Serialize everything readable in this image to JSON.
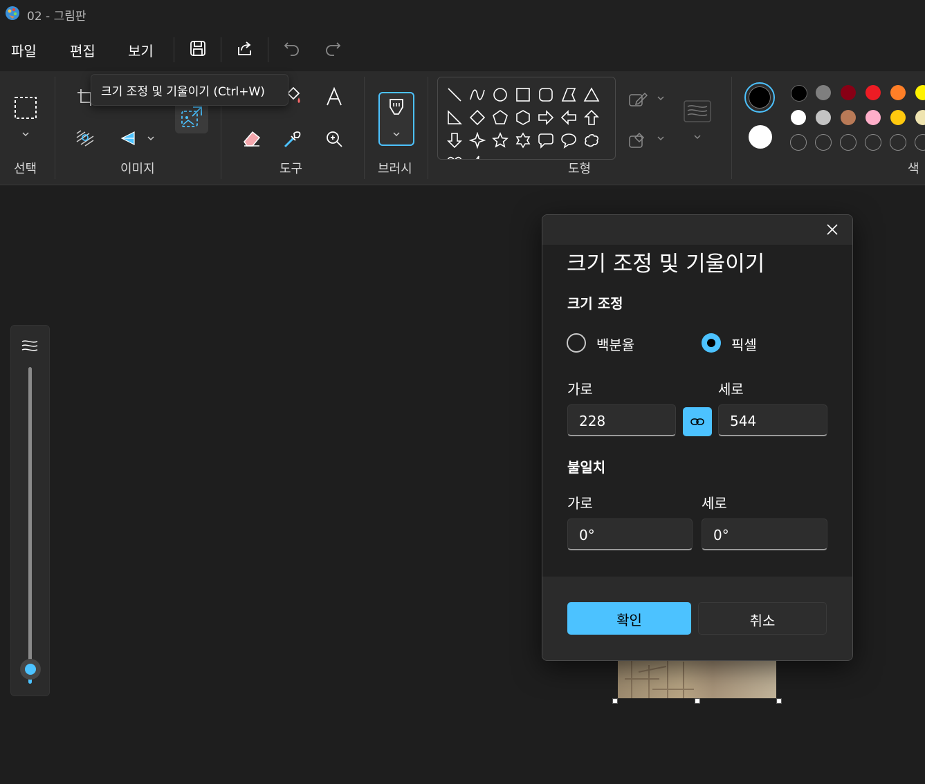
{
  "window": {
    "title": "02 - 그림판"
  },
  "menu": {
    "file": "파일",
    "edit": "편집",
    "view": "보기"
  },
  "ribbon": {
    "groups": {
      "select": "선택",
      "image": "이미지",
      "tools": "도구",
      "brush": "브러시",
      "shapes": "도형",
      "color": "색"
    },
    "tooltip": "크기 조정 및 기울이기 (Ctrl+W)"
  },
  "colors": {
    "primary": "#000000",
    "secondary": "#ffffff",
    "accent": "#4cc2ff",
    "palette_row1": [
      "#000000",
      "#7f7f7f",
      "#880015",
      "#ed1c24",
      "#ff7f27",
      "#fff200"
    ],
    "palette_row2": [
      "#ffffff",
      "#c3c3c3",
      "#b97a57",
      "#ffaec9",
      "#ffc90e",
      "#efe4b0"
    ]
  },
  "dialog": {
    "title": "크기 조정 및 기울이기",
    "resize_section": "크기 조정",
    "option_percent": "백분율",
    "option_pixel": "픽셀",
    "selected_option": "픽셀",
    "horizontal_label": "가로",
    "vertical_label": "세로",
    "width_value": "228",
    "height_value": "544",
    "skew_section": "불일치",
    "skew_horizontal_label": "가로",
    "skew_vertical_label": "세로",
    "skew_horizontal_value": "0°",
    "skew_vertical_value": "0°",
    "ok": "확인",
    "cancel": "취소"
  },
  "brush_size_slider": {
    "value_fraction": 0.02
  }
}
